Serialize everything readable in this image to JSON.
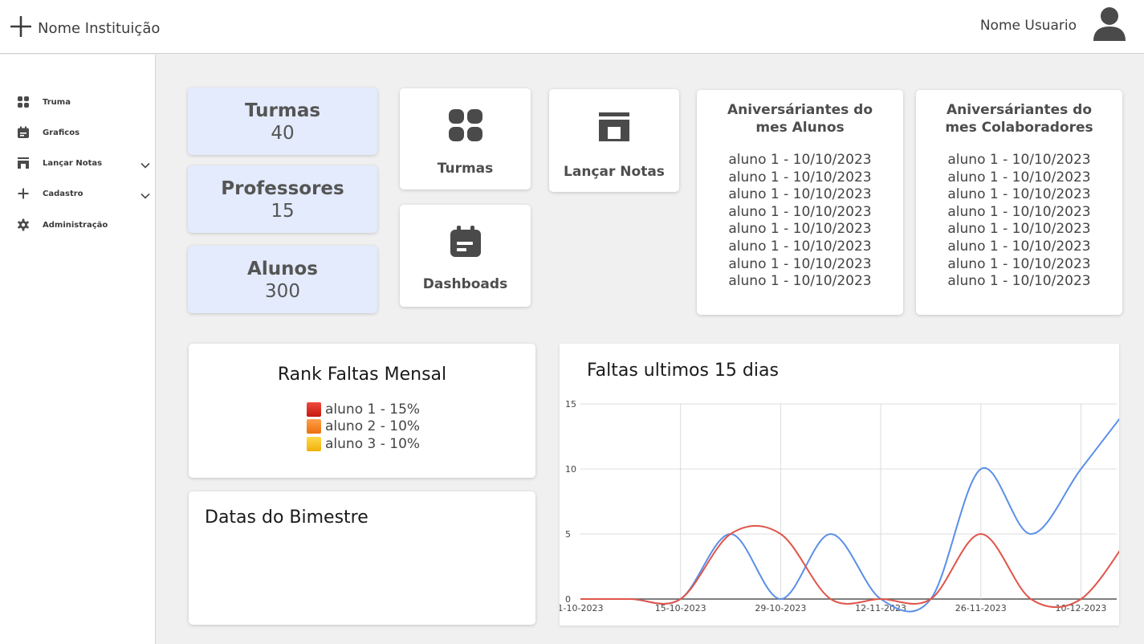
{
  "header": {
    "institution": "Nome Instituição",
    "user_name": "Nome Usuario",
    "icons": {
      "logo": "sparkle-icon",
      "avatar": "user-avatar-icon"
    }
  },
  "sidebar": {
    "items": [
      {
        "label": "Truma",
        "icon": "grid-icon",
        "has_chevron": false
      },
      {
        "label": "Graficos",
        "icon": "calendar-icon",
        "has_chevron": false
      },
      {
        "label": "Lançar Notas",
        "icon": "storefront-icon",
        "has_chevron": true
      },
      {
        "label": "Cadastro",
        "icon": "plus-icon",
        "has_chevron": true
      },
      {
        "label": "Administração",
        "icon": "gear-icon",
        "has_chevron": false
      }
    ]
  },
  "stats": [
    {
      "title": "Turmas",
      "value": "40"
    },
    {
      "title": "Professores",
      "value": "15"
    },
    {
      "title": "Alunos",
      "value": "300"
    }
  ],
  "shortcuts": {
    "turmas": "Turmas",
    "dashboards": "Dashboads",
    "lancar_notas": "Lançar Notas"
  },
  "birthdays": {
    "students": {
      "title": "Aniversáriantes do mes Alunos",
      "entries": [
        "aluno 1 - 10/10/2023",
        "aluno 1 - 10/10/2023",
        "aluno 1 - 10/10/2023",
        "aluno 1 - 10/10/2023",
        "aluno 1 - 10/10/2023",
        "aluno 1 - 10/10/2023",
        "aluno 1 - 10/10/2023",
        "aluno 1 - 10/10/2023"
      ]
    },
    "staff": {
      "title": "Aniversáriantes do mes Colaboradores",
      "entries": [
        "aluno 1 - 10/10/2023",
        "aluno 1 - 10/10/2023",
        "aluno 1 - 10/10/2023",
        "aluno 1 - 10/10/2023",
        "aluno 1 - 10/10/2023",
        "aluno 1 - 10/10/2023",
        "aluno 1 - 10/10/2023",
        "aluno 1 - 10/10/2023"
      ]
    }
  },
  "rank": {
    "title": "Rank Faltas Mensal",
    "items": [
      {
        "label": "aluno 1 - 15%",
        "color": "#e0281b"
      },
      {
        "label": "aluno 2 - 10%",
        "color": "#f7821d"
      },
      {
        "label": "aluno 3 - 10%",
        "color": "#f7c21a"
      }
    ]
  },
  "bimestre": {
    "title": "Datas do Bimestre"
  },
  "colors": {
    "stat_bg": "#e3ebfc",
    "series_blue": "#5b8fe8",
    "series_red": "#e0554a"
  },
  "chart_data": {
    "type": "line",
    "title": "Faltas ultimos 15 dias",
    "xlabel": "",
    "ylabel": "",
    "x_ticks": [
      "1-10-2023",
      "15-10-2023",
      "29-10-2023",
      "12-11-2023",
      "26-11-2023",
      "10-12-2023"
    ],
    "y_ticks": [
      0,
      5,
      10,
      15
    ],
    "ylim": [
      0,
      15
    ],
    "xlim": [
      "2023-10-01",
      "2023-12-15"
    ],
    "grid": true,
    "smooth": true,
    "series": [
      {
        "color": "#5b8fe8",
        "points": [
          [
            "2023-10-01",
            0
          ],
          [
            "2023-10-08",
            0
          ],
          [
            "2023-10-15",
            0
          ],
          [
            "2023-10-22",
            5
          ],
          [
            "2023-10-29",
            0
          ],
          [
            "2023-11-05",
            5
          ],
          [
            "2023-11-12",
            0
          ],
          [
            "2023-11-19",
            0
          ],
          [
            "2023-11-26",
            10
          ],
          [
            "2023-12-03",
            5
          ],
          [
            "2023-12-10",
            10
          ],
          [
            "2023-12-17",
            15
          ]
        ]
      },
      {
        "color": "#e0554a",
        "points": [
          [
            "2023-10-01",
            0
          ],
          [
            "2023-10-08",
            0
          ],
          [
            "2023-10-15",
            0
          ],
          [
            "2023-10-22",
            5
          ],
          [
            "2023-10-29",
            5
          ],
          [
            "2023-11-05",
            0
          ],
          [
            "2023-11-12",
            0
          ],
          [
            "2023-11-19",
            0
          ],
          [
            "2023-11-26",
            5
          ],
          [
            "2023-12-03",
            0
          ],
          [
            "2023-12-10",
            0
          ],
          [
            "2023-12-17",
            5
          ]
        ]
      }
    ]
  }
}
